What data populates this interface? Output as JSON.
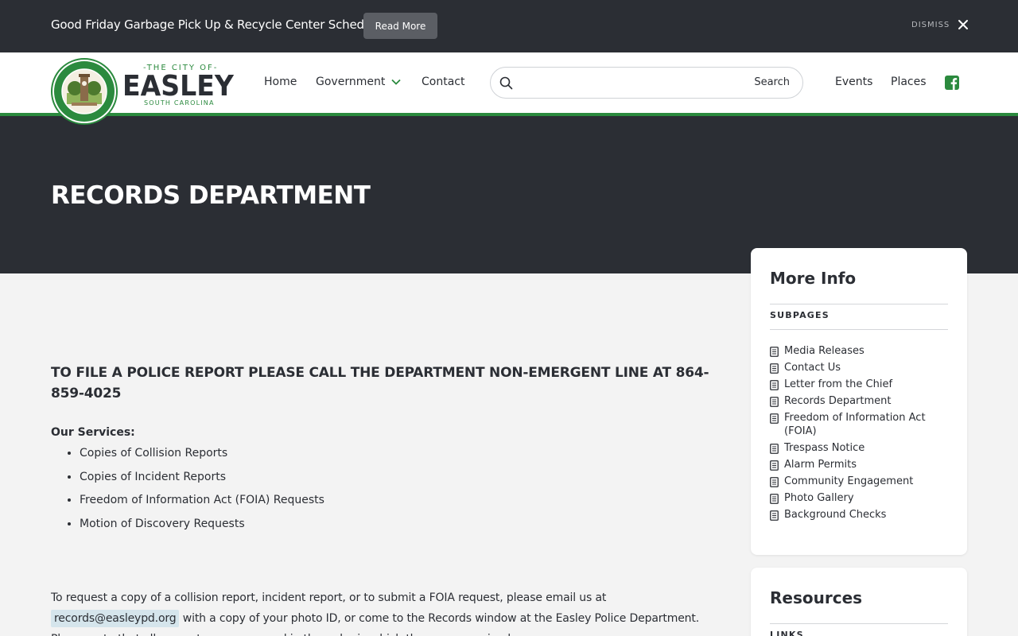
{
  "alert": {
    "text": "Good Friday Garbage Pick Up & Recycle Center Schedule",
    "button": "Read More",
    "dismiss": "DISMISS"
  },
  "logo": {
    "top": "-THE CITY OF-",
    "main": "EASLEY",
    "sub": "SOUTH CAROLINA"
  },
  "nav": {
    "home": "Home",
    "government": "Government",
    "contact": "Contact",
    "events": "Events",
    "places": "Places"
  },
  "search": {
    "placeholder": "",
    "button": "Search"
  },
  "hero": {
    "title": "RECORDS DEPARTMENT"
  },
  "main": {
    "heading": "TO FILE A POLICE REPORT PLEASE CALL THE DEPARTMENT NON-EMERGENT LINE AT 864-859-4025",
    "services_label": "Our Services:",
    "services": [
      "Copies of Collision Reports",
      "Copies of Incident Reports",
      "Freedom of Information Act (FOIA) Requests",
      "Motion of Discovery Requests"
    ],
    "para_before": "To request a copy of a collision report, incident report, or to submit a FOIA request, please email us at ",
    "email": "records@easleypd.org",
    "para_after": " with a copy of your photo ID, or come to the Records window at the Easley Police Department. Please note that all requests are processed in the order in which they were received."
  },
  "sidebar": {
    "more_info": "More Info",
    "subpages_label": "SUBPAGES",
    "subpages": [
      "Media Releases",
      "Contact Us",
      "Letter from the Chief",
      "Records Department",
      "Freedom of Information Act (FOIA)",
      "Trespass Notice",
      "Alarm Permits",
      "Community Engagement",
      "Photo Gallery",
      "Background Checks"
    ],
    "resources": "Resources",
    "links_label": "LINKS"
  },
  "colors": {
    "dark": "#2b2e34",
    "green": "#2b8a3e",
    "email_bg": "#d5e5ec"
  }
}
